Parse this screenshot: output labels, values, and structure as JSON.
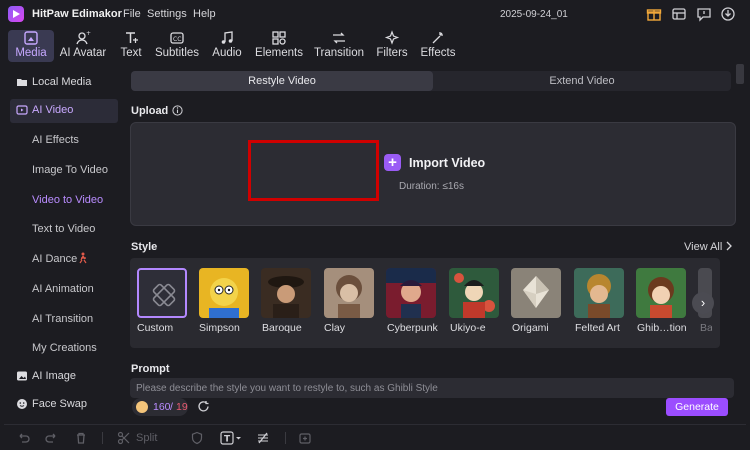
{
  "window": {
    "app_name": "HitPaw Edimakor",
    "menu": [
      "File",
      "Settings",
      "Help"
    ],
    "doc_title": "2025-09-24_01"
  },
  "toolbar": {
    "tabs": [
      {
        "label": "Media",
        "icon": "media-icon"
      },
      {
        "label": "AI Avatar",
        "icon": "ai-avatar-icon"
      },
      {
        "label": "Text",
        "icon": "text-icon"
      },
      {
        "label": "Subtitles",
        "icon": "subtitles-icon"
      },
      {
        "label": "Audio",
        "icon": "audio-icon"
      },
      {
        "label": "Elements",
        "icon": "elements-icon"
      },
      {
        "label": "Transition",
        "icon": "transition-icon"
      },
      {
        "label": "Filters",
        "icon": "filters-icon"
      },
      {
        "label": "Effects",
        "icon": "effects-icon"
      }
    ],
    "active": "Media"
  },
  "sidebar": {
    "top_items": [
      {
        "label": "Local Media",
        "icon": "folder-icon"
      },
      {
        "label": "AI Video",
        "icon": "ai-video-icon"
      }
    ],
    "sub_items": [
      "AI Effects",
      "Image To Video",
      "Video to Video",
      "Text to Video",
      "AI Dance",
      "AI Animation",
      "AI Transition",
      "My Creations"
    ],
    "active_sub": "Video to Video",
    "bottom_items": [
      {
        "label": "AI Image",
        "icon": "ai-image-icon"
      },
      {
        "label": "Face Swap",
        "icon": "face-swap-icon"
      }
    ]
  },
  "main": {
    "tabs": [
      "Restyle Video",
      "Extend Video"
    ],
    "active_tab": "Restyle Video",
    "upload_label": "Upload",
    "import_label": "Import Video",
    "duration_hint": "Duration: ≤16s",
    "style_label": "Style",
    "view_all": "View All",
    "styles": [
      "Custom",
      "Simpson",
      "Baroque",
      "Clay",
      "Cyberpunk",
      "Ukiyo-e",
      "Origami",
      "Felted Art",
      "Ghib…tion",
      "Bar"
    ],
    "selected_style": "Custom",
    "prompt_label": "Prompt",
    "prompt_placeholder": "Please describe the style you want to restyle to, such as Ghibli Style",
    "credits_used": "160",
    "credits_sep": "/",
    "credits_total": "19",
    "generate_label": "Generate"
  },
  "bottom_toolbar": {
    "split_label": "Split"
  },
  "colors": {
    "background": "#1c1c21",
    "accent": "#9b4dff",
    "highlight_box": "#d00000"
  }
}
